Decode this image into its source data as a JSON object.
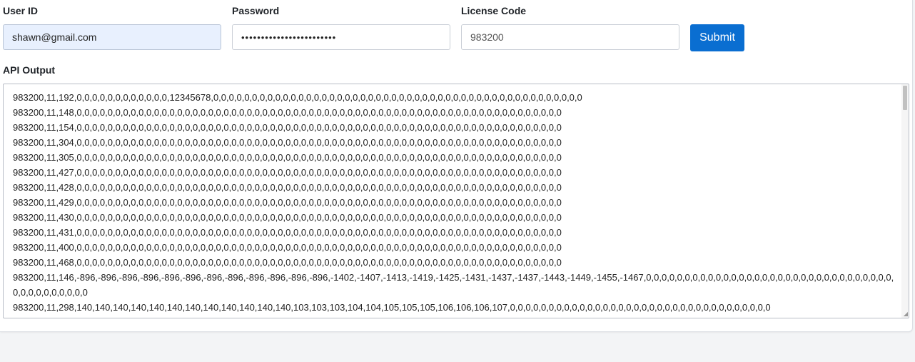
{
  "form": {
    "user_id_label": "User ID",
    "user_id_value": "shawn@gmail.com",
    "password_label": "Password",
    "password_value": "••••••••••••••••••••••••",
    "license_label": "License Code",
    "license_value": "983200",
    "submit_label": "Submit"
  },
  "output": {
    "label": "API Output",
    "lines": [
      "983200,11,192,0,0,0,0,0,0,0,0,0,0,0,0,12345678,0,0,0,0,0,0,0,0,0,0,0,0,0,0,0,0,0,0,0,0,0,0,0,0,0,0,0,0,0,0,0,0,0,0,0,0,0,0,0,0,0,0,0,0,0,0,0,0",
      "983200,11,148,0,0,0,0,0,0,0,0,0,0,0,0,0,0,0,0,0,0,0,0,0,0,0,0,0,0,0,0,0,0,0,0,0,0,0,0,0,0,0,0,0,0,0,0,0,0,0,0,0,0,0,0,0,0,0,0,0,0,0,0,0,0,0",
      "983200,11,154,0,0,0,0,0,0,0,0,0,0,0,0,0,0,0,0,0,0,0,0,0,0,0,0,0,0,0,0,0,0,0,0,0,0,0,0,0,0,0,0,0,0,0,0,0,0,0,0,0,0,0,0,0,0,0,0,0,0,0,0,0,0,0",
      "983200,11,304,0,0,0,0,0,0,0,0,0,0,0,0,0,0,0,0,0,0,0,0,0,0,0,0,0,0,0,0,0,0,0,0,0,0,0,0,0,0,0,0,0,0,0,0,0,0,0,0,0,0,0,0,0,0,0,0,0,0,0,0,0,0,0",
      "983200,11,305,0,0,0,0,0,0,0,0,0,0,0,0,0,0,0,0,0,0,0,0,0,0,0,0,0,0,0,0,0,0,0,0,0,0,0,0,0,0,0,0,0,0,0,0,0,0,0,0,0,0,0,0,0,0,0,0,0,0,0,0,0,0,0",
      "983200,11,427,0,0,0,0,0,0,0,0,0,0,0,0,0,0,0,0,0,0,0,0,0,0,0,0,0,0,0,0,0,0,0,0,0,0,0,0,0,0,0,0,0,0,0,0,0,0,0,0,0,0,0,0,0,0,0,0,0,0,0,0,0,0,0",
      "983200,11,428,0,0,0,0,0,0,0,0,0,0,0,0,0,0,0,0,0,0,0,0,0,0,0,0,0,0,0,0,0,0,0,0,0,0,0,0,0,0,0,0,0,0,0,0,0,0,0,0,0,0,0,0,0,0,0,0,0,0,0,0,0,0,0",
      "983200,11,429,0,0,0,0,0,0,0,0,0,0,0,0,0,0,0,0,0,0,0,0,0,0,0,0,0,0,0,0,0,0,0,0,0,0,0,0,0,0,0,0,0,0,0,0,0,0,0,0,0,0,0,0,0,0,0,0,0,0,0,0,0,0,0",
      "983200,11,430,0,0,0,0,0,0,0,0,0,0,0,0,0,0,0,0,0,0,0,0,0,0,0,0,0,0,0,0,0,0,0,0,0,0,0,0,0,0,0,0,0,0,0,0,0,0,0,0,0,0,0,0,0,0,0,0,0,0,0,0,0,0,0",
      "983200,11,431,0,0,0,0,0,0,0,0,0,0,0,0,0,0,0,0,0,0,0,0,0,0,0,0,0,0,0,0,0,0,0,0,0,0,0,0,0,0,0,0,0,0,0,0,0,0,0,0,0,0,0,0,0,0,0,0,0,0,0,0,0,0,0",
      "983200,11,400,0,0,0,0,0,0,0,0,0,0,0,0,0,0,0,0,0,0,0,0,0,0,0,0,0,0,0,0,0,0,0,0,0,0,0,0,0,0,0,0,0,0,0,0,0,0,0,0,0,0,0,0,0,0,0,0,0,0,0,0,0,0,0",
      "983200,11,468,0,0,0,0,0,0,0,0,0,0,0,0,0,0,0,0,0,0,0,0,0,0,0,0,0,0,0,0,0,0,0,0,0,0,0,0,0,0,0,0,0,0,0,0,0,0,0,0,0,0,0,0,0,0,0,0,0,0,0,0,0,0,0",
      "983200,11,146,-896,-896,-896,-896,-896,-896,-896,-896,-896,-896,-896,-896,-1402,-1407,-1413,-1419,-1425,-1431,-1437,-1437,-1443,-1449,-1455,-1467,0,0,0,0,0,0,0,0,0,0,0,0,0,0,0,0,0,0,0,0,0,0,0,0,0,0,0,0,0,0,0,0,0,0,0,0,0,0,0,0,0,0",
      "983200,11,298,140,140,140,140,140,140,140,140,140,140,140,140,103,103,103,104,104,105,105,105,106,106,106,107,0,0,0,0,0,0,0,0,0,0,0,0,0,0,0,0,0,0,0,0,0,0,0,0,0,0,0,0,0,0,0,0,0,0"
    ]
  },
  "colors": {
    "accent": "#0a6ed1",
    "autofill_bg": "#e8f0fe",
    "page_bg": "#f3f4f6"
  }
}
